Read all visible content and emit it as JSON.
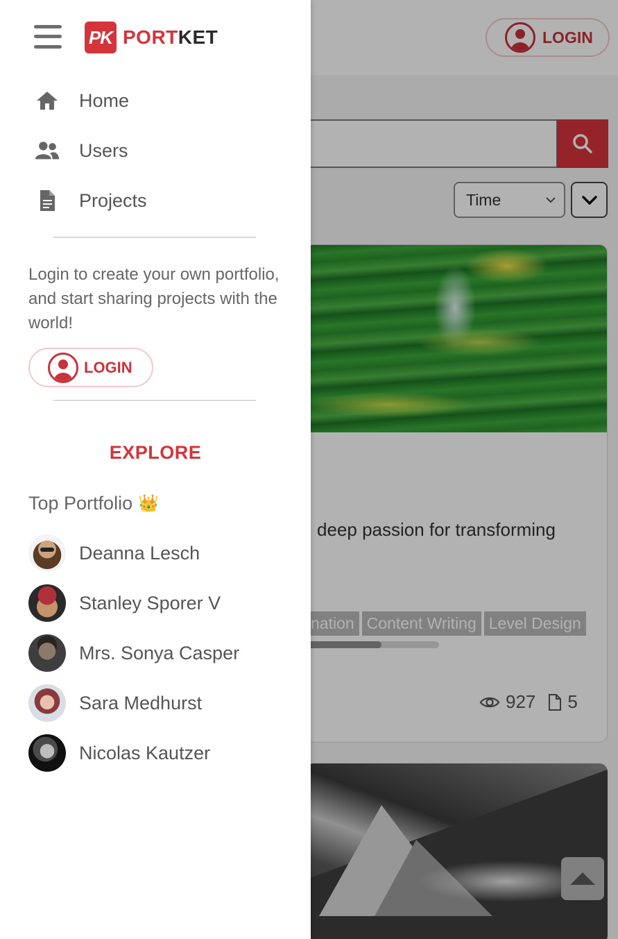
{
  "app": {
    "logo_mark": "PK",
    "logo_text_red": "PORT",
    "logo_text_dark": "KET",
    "brand_color": "#d4343c"
  },
  "header": {
    "login_label": "LOGIN"
  },
  "search": {
    "placeholder": "",
    "button_icon": "search-icon"
  },
  "sort": {
    "selected": "Time",
    "options": [
      "Time"
    ],
    "order_icon": "chevron-down-icon"
  },
  "drawer": {
    "nav": [
      {
        "label": "Home",
        "icon": "home-icon"
      },
      {
        "label": "Users",
        "icon": "users-icon"
      },
      {
        "label": "Projects",
        "icon": "document-icon"
      }
    ],
    "promo_text": "Login to create your own portfolio, and start sharing projects with the world!",
    "login_label": "LOGIN",
    "explore_label": "EXPLORE",
    "top_portfolio_label": "Top Portfolio",
    "top_portfolio_emoji": "👑",
    "top_portfolio": [
      {
        "name": "Deanna Lesch"
      },
      {
        "name": "Stanley Sporer V"
      },
      {
        "name": "Mrs. Sonya Casper"
      },
      {
        "name": "Sara Medhurst"
      },
      {
        "name": "Nicolas Kautzer"
      }
    ]
  },
  "cards": [
    {
      "description_visible": "deep passion for transforming",
      "tags": [
        "nation",
        "Content Writing",
        "Level Design"
      ],
      "progress_fraction": 0.57,
      "views": "927",
      "projects": "5"
    }
  ]
}
